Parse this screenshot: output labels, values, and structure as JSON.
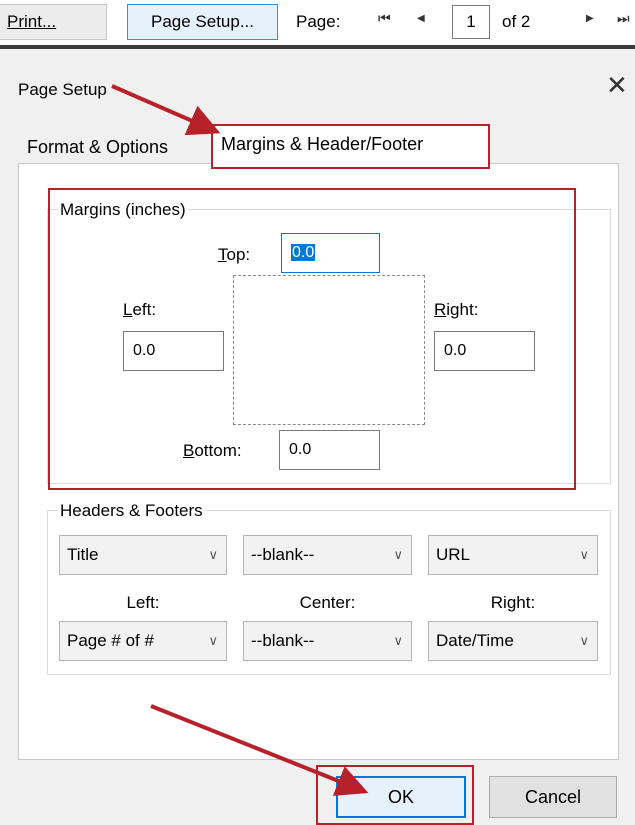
{
  "toolbar": {
    "print_label": "Print...",
    "page_setup_label": "Page Setup...",
    "page_label": "Page:",
    "current_page": "1",
    "of_text": "of 2"
  },
  "dialog": {
    "title": "Page Setup",
    "tabs": [
      {
        "label": "Format & Options"
      },
      {
        "label": "Margins & Header/Footer"
      }
    ],
    "margins": {
      "group_label": "Margins (inches)",
      "top_label": "Top:",
      "top_value": "0.0",
      "left_label": "Left:",
      "left_value": "0.0",
      "right_label": "Right:",
      "right_value": "0.0",
      "bottom_label": "Bottom:",
      "bottom_value": "0.0"
    },
    "headers_footers": {
      "group_label": "Headers & Footers",
      "header_left": "Title",
      "header_center": "--blank--",
      "header_right": "URL",
      "left_label": "Left:",
      "center_label": "Center:",
      "right_label": "Right:",
      "footer_left": "Page # of #",
      "footer_center": "--blank--",
      "footer_right": "Date/Time"
    },
    "ok_label": "OK",
    "cancel_label": "Cancel"
  },
  "colors": {
    "annotation_red": "#b8202a",
    "focus_blue": "#0078d7"
  }
}
